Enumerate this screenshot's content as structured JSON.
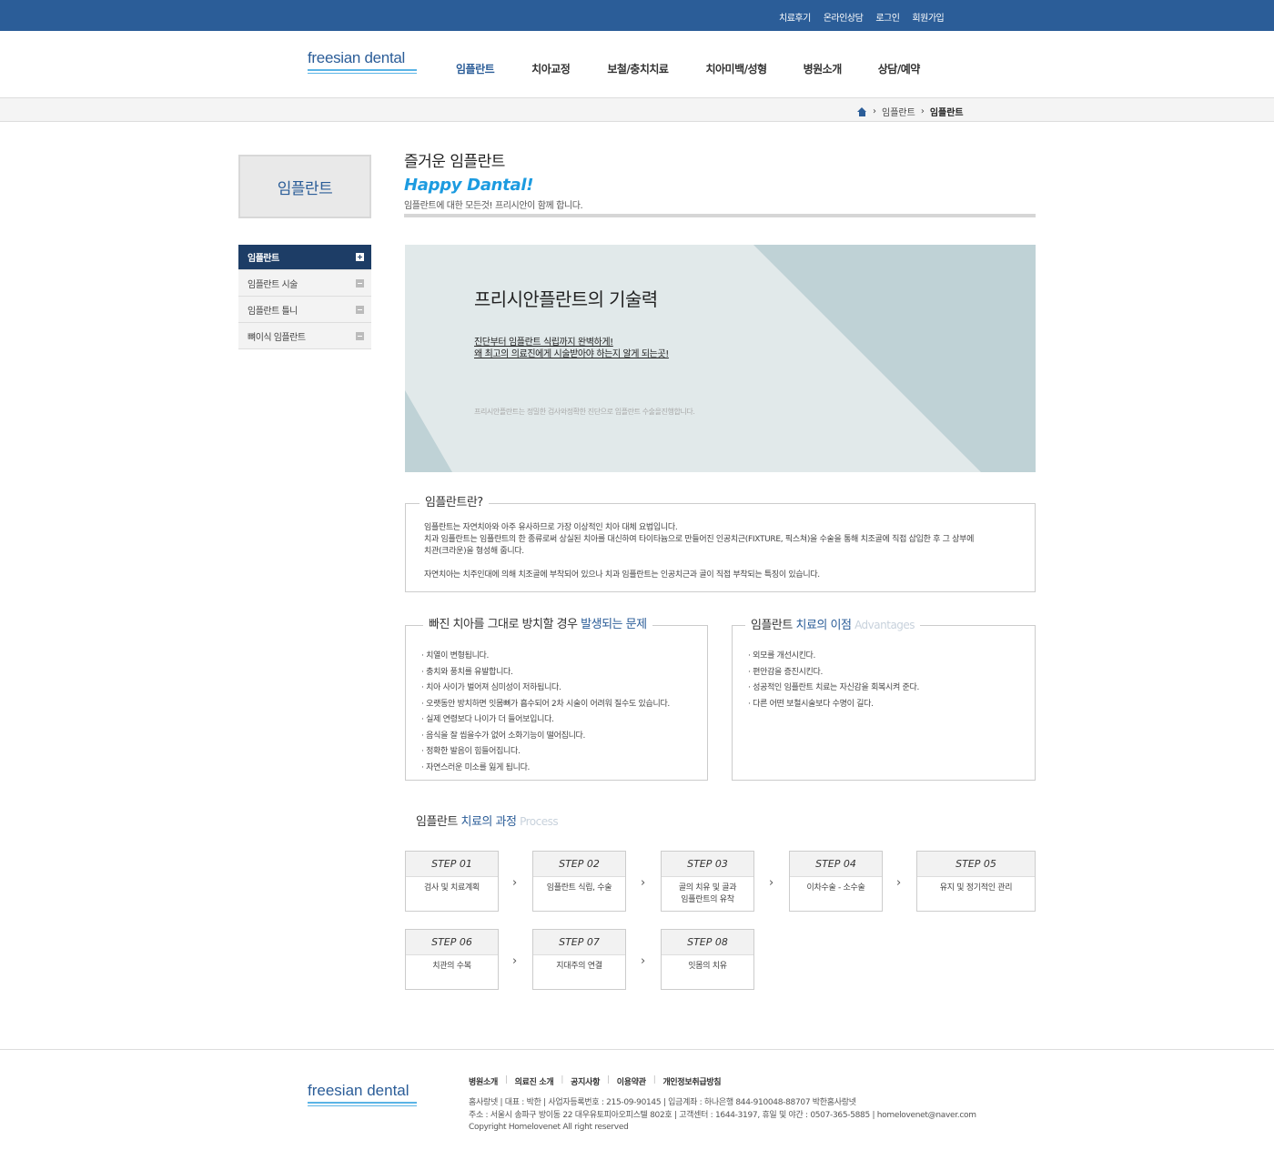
{
  "topbar": {
    "links": [
      "치료후기",
      "온라인상담",
      "로그인",
      "회원가입"
    ]
  },
  "header": {
    "logo_text": "freesian dental",
    "nav": [
      "임플란트",
      "치아교정",
      "보철/충치치료",
      "치아미백/성형",
      "병원소개",
      "상담/예약"
    ]
  },
  "breadcrumb": {
    "items": [
      "임플란트",
      "임플란트"
    ]
  },
  "sidebar": {
    "title": "임플란트",
    "items": [
      "임플란트",
      "임플란트 시술",
      "임플란트 틀니",
      "뼈이식 임플란트"
    ]
  },
  "content": {
    "title": "즐거운 임플란트",
    "slogan": "Happy Dantal!",
    "subtitle": "임플란트에 대한 모든것! 프리시안이 함께 합니다."
  },
  "banner": {
    "title": "프리시안플란트의 기술력",
    "line1": "진단부터 임플란트 식립까지 완벽하게!",
    "line2": "왜 최고의 의료진에게 시술받아야 하는지 알게 되는곳!",
    "note": "프리시안플란트는 정밀한 검사와정확한 진단으로 임플란트 수술을진행합니다."
  },
  "intro": {
    "legend": "임플란트란?",
    "p1": "임플란트는 자연치아와 아주 유사하므로 가장 이상적인 치아 대체 요법입니다.",
    "p2": "치과 임플란트는 임플란트의 한 종류로써 상실된 치아를 대신하여 타이타늄으로 만들어진 인공치근(FIXTURE, 픽스쳐)을 수술을 통해 치조골에 직접 삽입한 후 그 상부에",
    "p3": "치관(크라운)을 형성해 줍니다.",
    "p4": "자연치아는 치주인대에 의해 치조골에 부착되어 있으나 치과 임플란트는 인공치근과 골이 직접 부착되는 특징이 있습니다."
  },
  "problems": {
    "legend_a": "빠진 치아를 그대로 방치할 경우 ",
    "legend_b": "발생되는 문제",
    "items": [
      "· 치열이 변형됩니다.",
      "· 충치와 풍치를 유발합니다.",
      "· 치아 사이가 벌어져 심미성이 저하됩니다.",
      "· 오랫동안 방치하면 잇몸뼈가 흡수되어 2차 시술이 어려워 질수도 있습니다.",
      "· 실제 연령보다 나이가 더 들어보입니다.",
      "· 음식을 잘 씹을수가 없어 소화기능이 떨어집니다.",
      "· 정확한 발음이 힘들어집니다.",
      "· 자연스러운 미소를 잃게 됩니다."
    ]
  },
  "advantages": {
    "legend_a": "임플란트 ",
    "legend_b": "치료의 이점",
    "legend_en": "Advantages",
    "items": [
      "· 외모를 개선시킨다.",
      "· 편안감을 증진시킨다.",
      "· 성공적인 임플란트 치료는 자신감을 회복시켜 준다.",
      "· 다른 어떤 보철시술보다 수명이 길다."
    ]
  },
  "process": {
    "title_a": "임플란트 ",
    "title_b": "치료의 과정",
    "title_en": "Process",
    "steps": [
      {
        "label": "STEP 01",
        "desc": "검사 및 치료계획"
      },
      {
        "label": "STEP 02",
        "desc": "임플란트 식립, 수술"
      },
      {
        "label": "STEP 03",
        "desc": "골의 치유 및 골과 임플란트의 유착"
      },
      {
        "label": "STEP 04",
        "desc": "이차수술 - 소수술"
      },
      {
        "label": "STEP 05",
        "desc": "유지 및 정기적인 관리"
      },
      {
        "label": "STEP 06",
        "desc": "치관의 수복"
      },
      {
        "label": "STEP 07",
        "desc": "지대주의 연결"
      },
      {
        "label": "STEP 08",
        "desc": "잇몸의 치유"
      }
    ]
  },
  "footer": {
    "logo_text": "freesian dental",
    "nav": [
      "병원소개",
      "의료진 소개",
      "공지사항",
      "이용약관",
      "개인정보취급방침"
    ],
    "info1": "홈사랑넷  |  대표 : 박한  |  사업자등록번호 : 215-09-90145  |  입금계좌 : 하나은행 844-910048-88707 박한홈사랑넷",
    "info2": "주소 : 서울시 송파구 방이동 22 대우유토피아오피스텔 802호  |  고객센터 : 1644-3197, 휴일 및 야간 : 0507-365-5885  |  homelovenet@naver.com",
    "copyright": "Copyright Homelovenet All right reserved"
  },
  "colors": {
    "primary": "#2b5d98",
    "sidebar_active": "#1d3d66",
    "accent": "#1c9be0"
  }
}
